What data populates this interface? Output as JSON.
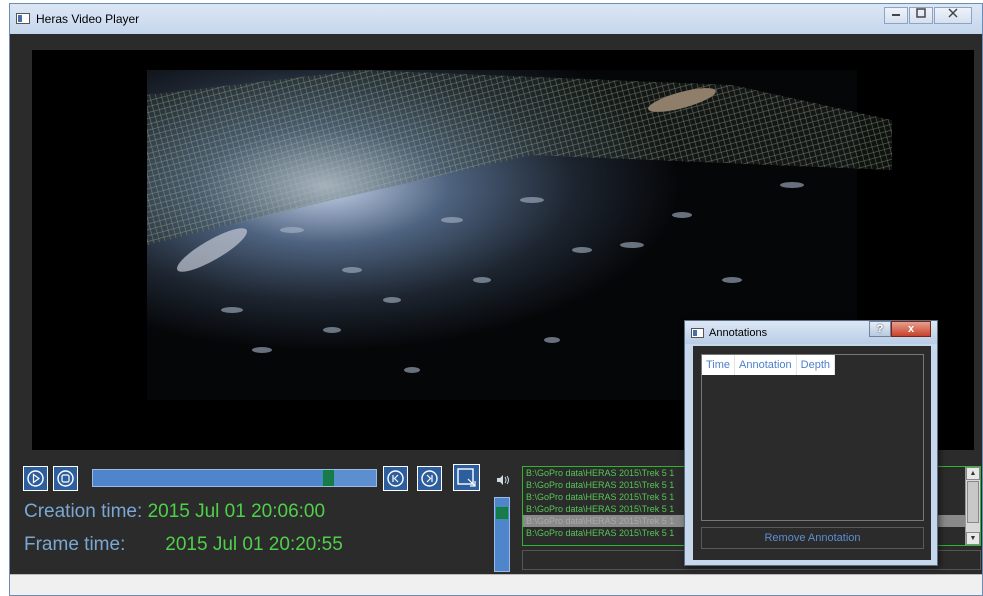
{
  "window": {
    "title": "Heras Video Player",
    "controls": [
      "minimize",
      "maximize",
      "close"
    ]
  },
  "colors": {
    "accent": "#4f86cb",
    "value_green": "#4fd04a",
    "label_blue": "#7aa7d4",
    "background": "#2b2b2b"
  },
  "player": {
    "seek_position": 0.83,
    "volume_level": 0.85,
    "buttons": {
      "play": "play-icon",
      "stop": "stop-icon",
      "prev": "skip-back-icon",
      "next": "skip-forward-icon",
      "select": "select-region-icon",
      "volume": "volume-icon"
    }
  },
  "info": {
    "creation_label": "Creation time:",
    "creation_value": "2015 Jul 01 20:06:00",
    "frame_label": "Frame time:",
    "frame_value": "2015 Jul 01 20:20:55"
  },
  "file_list": {
    "items": [
      "B:\\GoPro data\\HERAS 2015\\Trek 5 1",
      "B:\\GoPro data\\HERAS 2015\\Trek 5 1",
      "B:\\GoPro data\\HERAS 2015\\Trek 5 1",
      "B:\\GoPro data\\HERAS 2015\\Trek 5 1",
      "B:\\GoPro data\\HERAS 2015\\Trek 5 1",
      "B:\\GoPro data\\HERAS 2015\\Trek 5 1"
    ],
    "selected_index": 4
  },
  "annotations_dialog": {
    "title": "Annotations",
    "help_label": "?",
    "close_label": "x",
    "columns": [
      "Time",
      "Annotation",
      "Depth"
    ],
    "remove_label": "Remove Annotation"
  }
}
